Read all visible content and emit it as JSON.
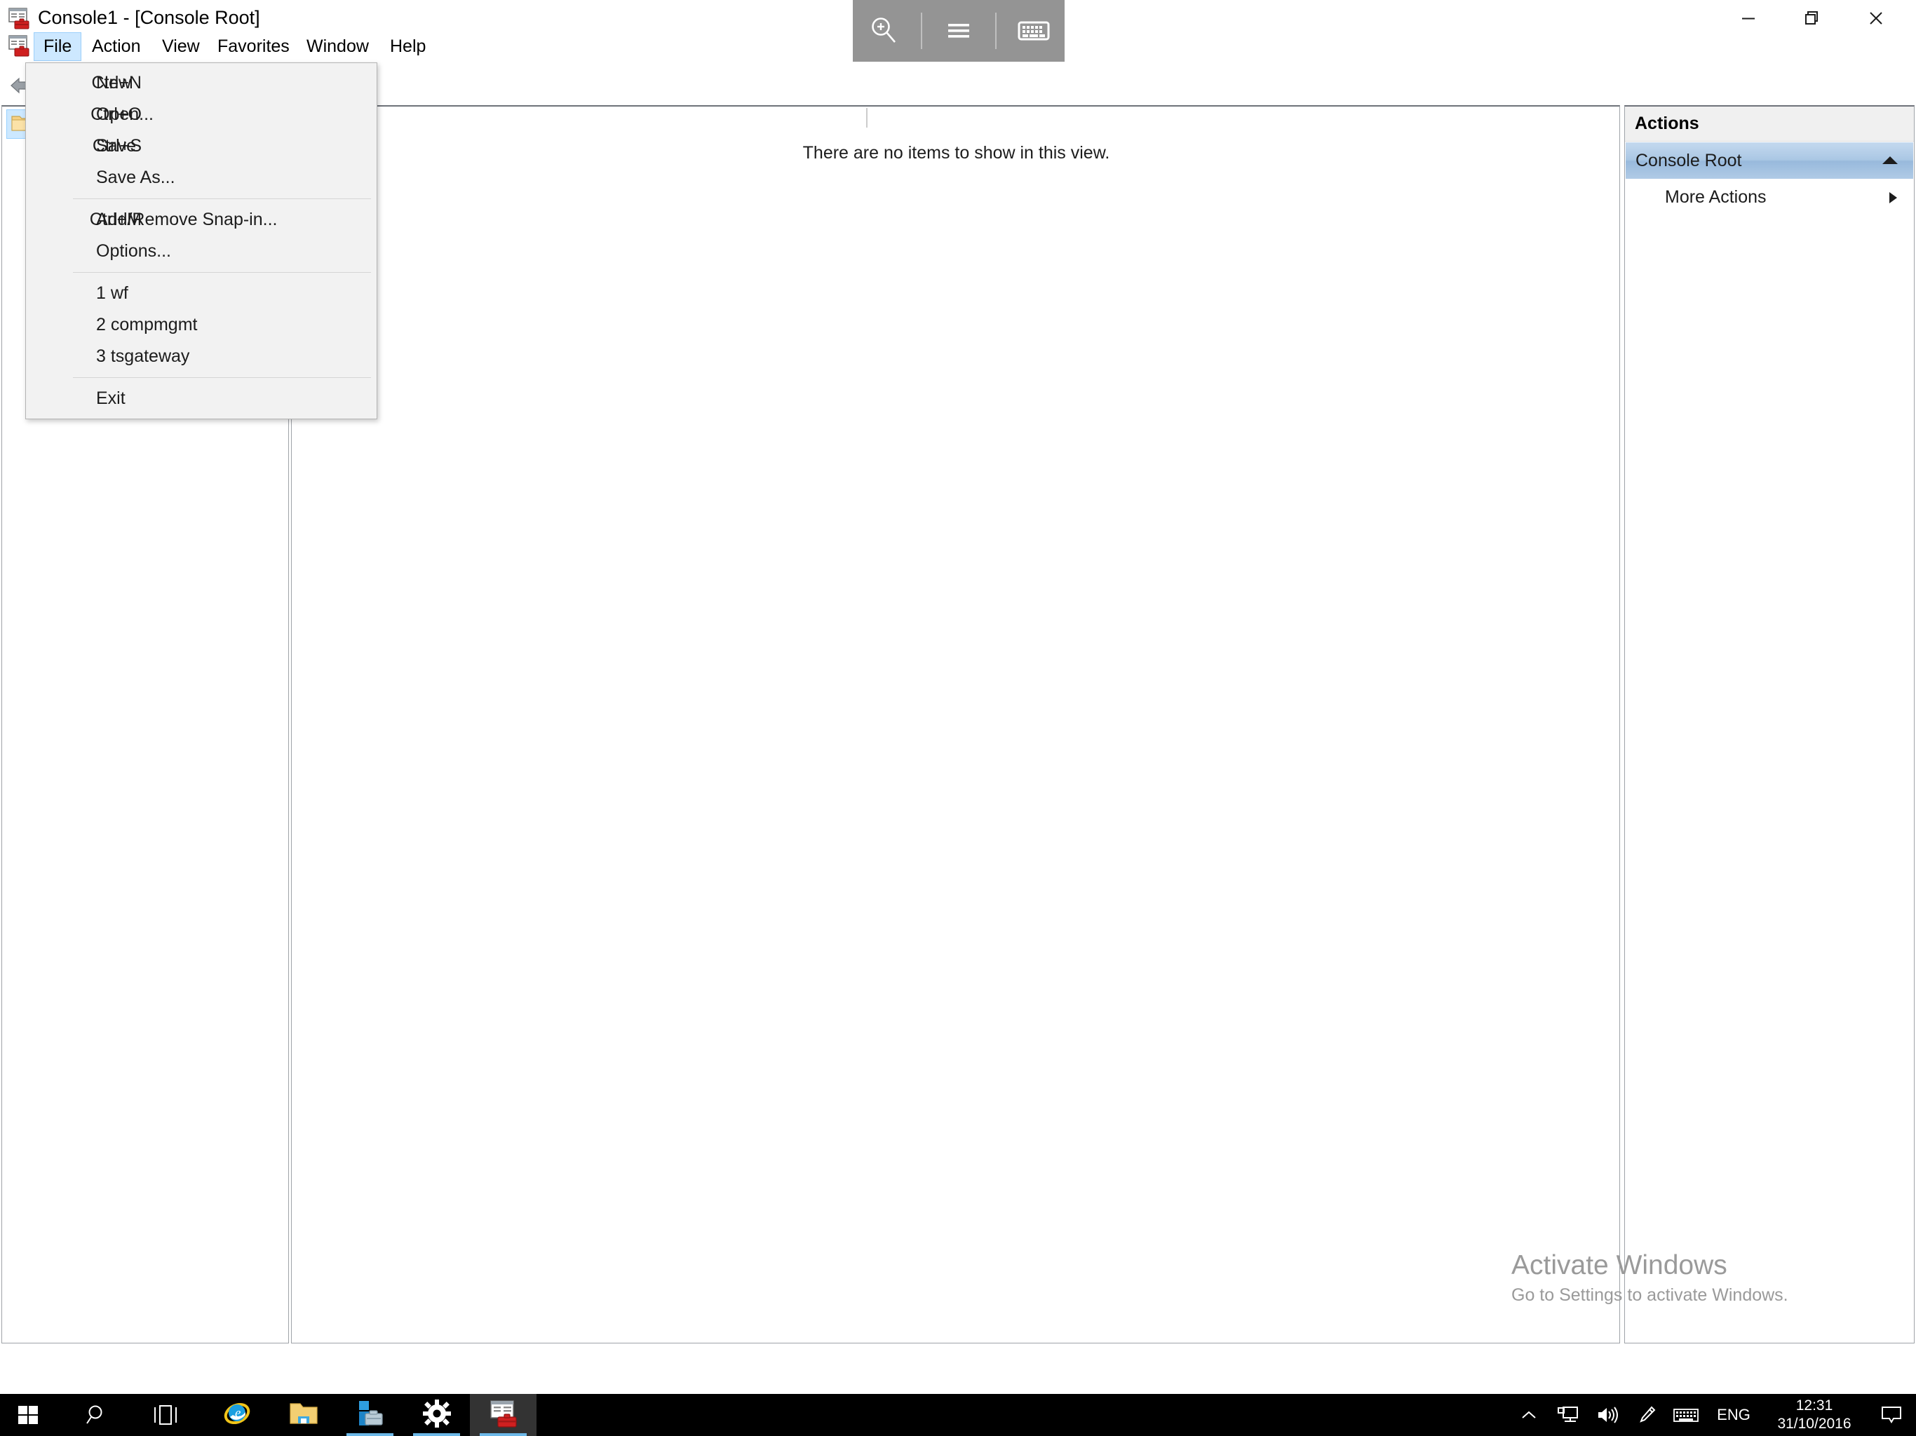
{
  "window": {
    "title": "Console1 - [Console Root]",
    "app_icon": "mmc-console-icon",
    "controls": {
      "minimize": "—",
      "maximize": "❐",
      "close": "✕"
    },
    "mdi_controls": {
      "minimize": "_",
      "restore": "❐",
      "close": "✕"
    }
  },
  "menubar": {
    "items": [
      {
        "label": "File",
        "active": true
      },
      {
        "label": "Action",
        "active": false
      },
      {
        "label": "View",
        "active": false
      },
      {
        "label": "Favorites",
        "active": false
      },
      {
        "label": "Window",
        "active": false
      },
      {
        "label": "Help",
        "active": false
      }
    ]
  },
  "accessibility_toolbar": {
    "magnifier_icon": "magnifier-plus-icon",
    "menu_icon": "hamburger-menu-icon",
    "keyboard_icon": "on-screen-keyboard-icon",
    "background_color": "#949494"
  },
  "toolbar": {
    "back_icon": "back-arrow-icon"
  },
  "file_menu": {
    "groups": [
      [
        {
          "label": "New",
          "shortcut": "Ctrl+N"
        },
        {
          "label": "Open...",
          "shortcut": "Ctrl+O"
        },
        {
          "label": "Save",
          "shortcut": "Ctrl+S"
        },
        {
          "label": "Save As...",
          "shortcut": ""
        }
      ],
      [
        {
          "label": "Add/Remove Snap-in...",
          "shortcut": "Ctrl+M"
        },
        {
          "label": "Options...",
          "shortcut": ""
        }
      ],
      [
        {
          "label": "1 wf",
          "shortcut": ""
        },
        {
          "label": "2 compmgmt",
          "shortcut": ""
        },
        {
          "label": "3 tsgateway",
          "shortcut": ""
        }
      ],
      [
        {
          "label": "Exit",
          "shortcut": ""
        }
      ]
    ]
  },
  "tree_pane": {
    "root_node_icon": "folder-icon",
    "root_node_selected": true
  },
  "result_pane": {
    "empty_message": "There are no items to show in this view."
  },
  "actions_pane": {
    "header": "Actions",
    "group": {
      "label": "Console Root",
      "collapse_icon": "chevron-up-icon"
    },
    "items": [
      {
        "label": "More Actions",
        "submenu_icon": "chevron-right-icon"
      }
    ]
  },
  "watermark": {
    "title": "Activate Windows",
    "subtitle": "Go to Settings to activate Windows.",
    "color": "#9a9a9a"
  },
  "taskbar": {
    "start_icon": "windows-start-icon",
    "search_icon": "search-icon",
    "taskview_icon": "task-view-icon",
    "apps": [
      {
        "name": "internet-explorer",
        "icon": "internet-explorer-icon",
        "running": false,
        "active": false
      },
      {
        "name": "file-explorer",
        "icon": "file-explorer-icon",
        "running": false,
        "active": false
      },
      {
        "name": "server-manager",
        "icon": "server-manager-icon",
        "running": true,
        "active": false
      },
      {
        "name": "settings",
        "icon": "gear-icon",
        "running": true,
        "active": false
      },
      {
        "name": "mmc-console",
        "icon": "mmc-console-icon",
        "running": true,
        "active": true
      }
    ],
    "tray": {
      "show_hidden_icon": "chevron-up-icon",
      "network_icon": "network-icon",
      "volume_icon": "volume-icon",
      "pen_icon": "pen-icon",
      "keyboard_icon": "touch-keyboard-icon",
      "language": "ENG",
      "time": "12:31",
      "date": "31/10/2016",
      "action_center_icon": "action-center-icon"
    }
  },
  "colors": {
    "menu_highlight": "#cde8ff",
    "actions_group_gradient_top": "#c4d9ef",
    "actions_group_gradient_bottom": "#b0cbe6",
    "taskbar_bg": "#000000",
    "pane_border": "#9fa3a8"
  }
}
